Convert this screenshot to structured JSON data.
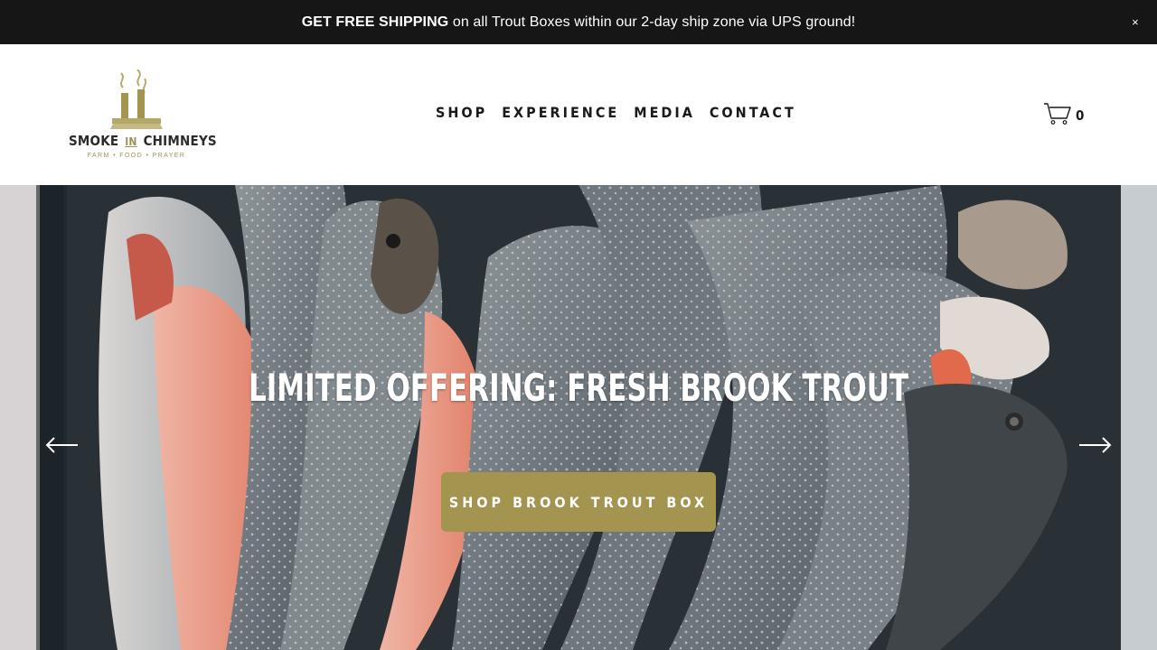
{
  "announcement": {
    "bold": "GET FREE SHIPPING",
    "text": " on all Trout Boxes within our 2-day ship zone via UPS ground!",
    "close_label": "×"
  },
  "logo": {
    "name_left": "SMOKE",
    "name_mid": "IN",
    "name_right": "CHIMNEYS",
    "tagline": "FARM • FOOD • PRAYER"
  },
  "nav": {
    "items": [
      {
        "label": "SHOP"
      },
      {
        "label": "EXPERIENCE"
      },
      {
        "label": "MEDIA"
      },
      {
        "label": "CONTACT"
      }
    ]
  },
  "cart": {
    "count": "0",
    "icon": "cart-icon"
  },
  "hero": {
    "title": "LIMITED OFFERING: FRESH BROOK TROUT",
    "button_label": "SHOP BROOK TROUT BOX",
    "prev_icon": "arrow-left-icon",
    "next_icon": "arrow-right-icon"
  },
  "colors": {
    "announcement_bg": "#161616",
    "accent": "#a3944f",
    "text_dark": "#1a1a1a"
  }
}
